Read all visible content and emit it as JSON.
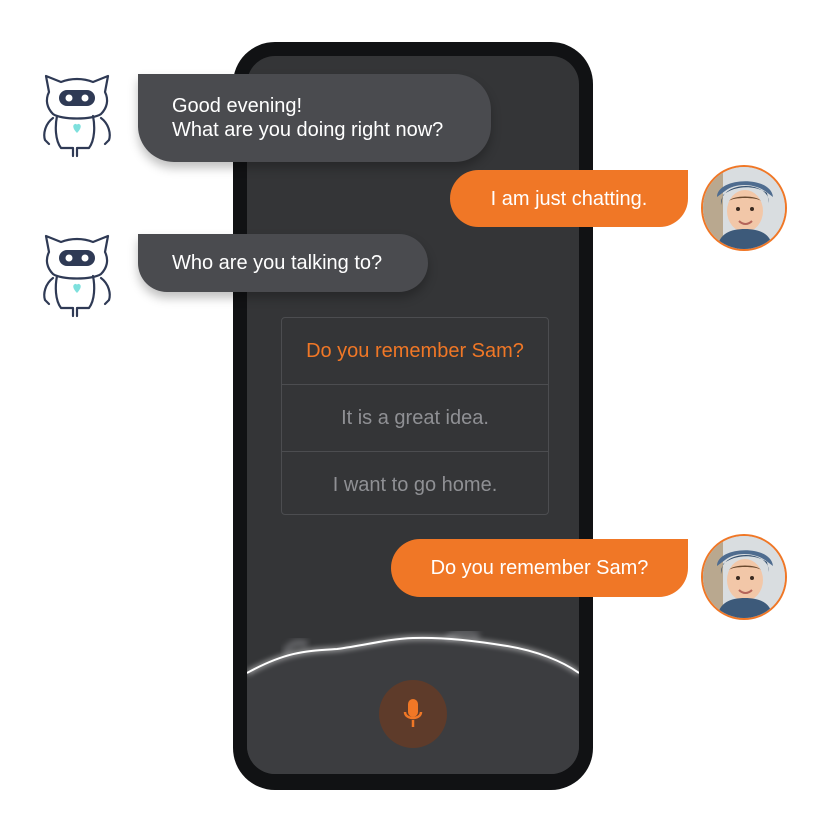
{
  "colors": {
    "accent": "#f07726",
    "bot_bubble": "#4a4b4f",
    "screen_bg": "#343537",
    "frame": "#111214",
    "robot_outline": "#2f3a55",
    "robot_heart": "#7ee0dd"
  },
  "conversation": {
    "messages": [
      {
        "sender": "bot",
        "lines": [
          "Good evening!",
          "What are you doing right now?"
        ]
      },
      {
        "sender": "user",
        "text": "I am just chatting."
      },
      {
        "sender": "bot",
        "text": "Who are you talking to?"
      },
      {
        "sender": "user",
        "text": "Do you remember Sam?"
      }
    ]
  },
  "suggestions": {
    "options": [
      "Do you remember Sam?",
      "It is a great idea.",
      "I want to go home."
    ],
    "selected_index": 0
  },
  "icons": {
    "bot_avatar": "robot-icon",
    "user_avatar": "child-avatar",
    "mic": "microphone-icon"
  }
}
